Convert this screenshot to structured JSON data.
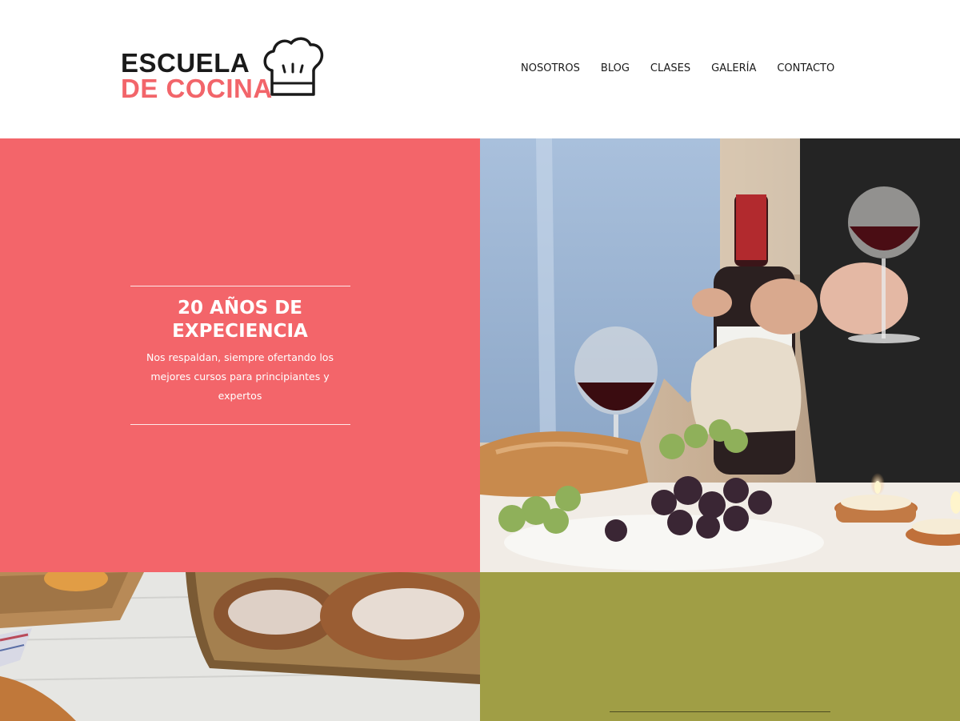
{
  "brand": {
    "line1": "ESCUELA",
    "line2": "DE COCINA",
    "accent_color": "#f2656a",
    "icon": "chef-hat-icon"
  },
  "nav": {
    "items": [
      {
        "label": "NOSOTROS"
      },
      {
        "label": "BLOG"
      },
      {
        "label": "CLASES"
      },
      {
        "label": "GALERÍA"
      },
      {
        "label": "CONTACTO"
      }
    ]
  },
  "hero": {
    "title_line1": "20 AÑOS DE",
    "title_line2": "EXPECIENCIA",
    "subtitle_line1": "Nos respaldan, siempre ofertando los",
    "subtitle_line2": "mejores cursos para principiantes y",
    "subtitle_line3": "expertos",
    "panel_color": "#f3656a"
  },
  "photos": {
    "wine_dinner": "wine-dinner-photo",
    "bread_basket": "bread-basket-photo"
  },
  "green_panel": {
    "color": "#a09e45"
  }
}
